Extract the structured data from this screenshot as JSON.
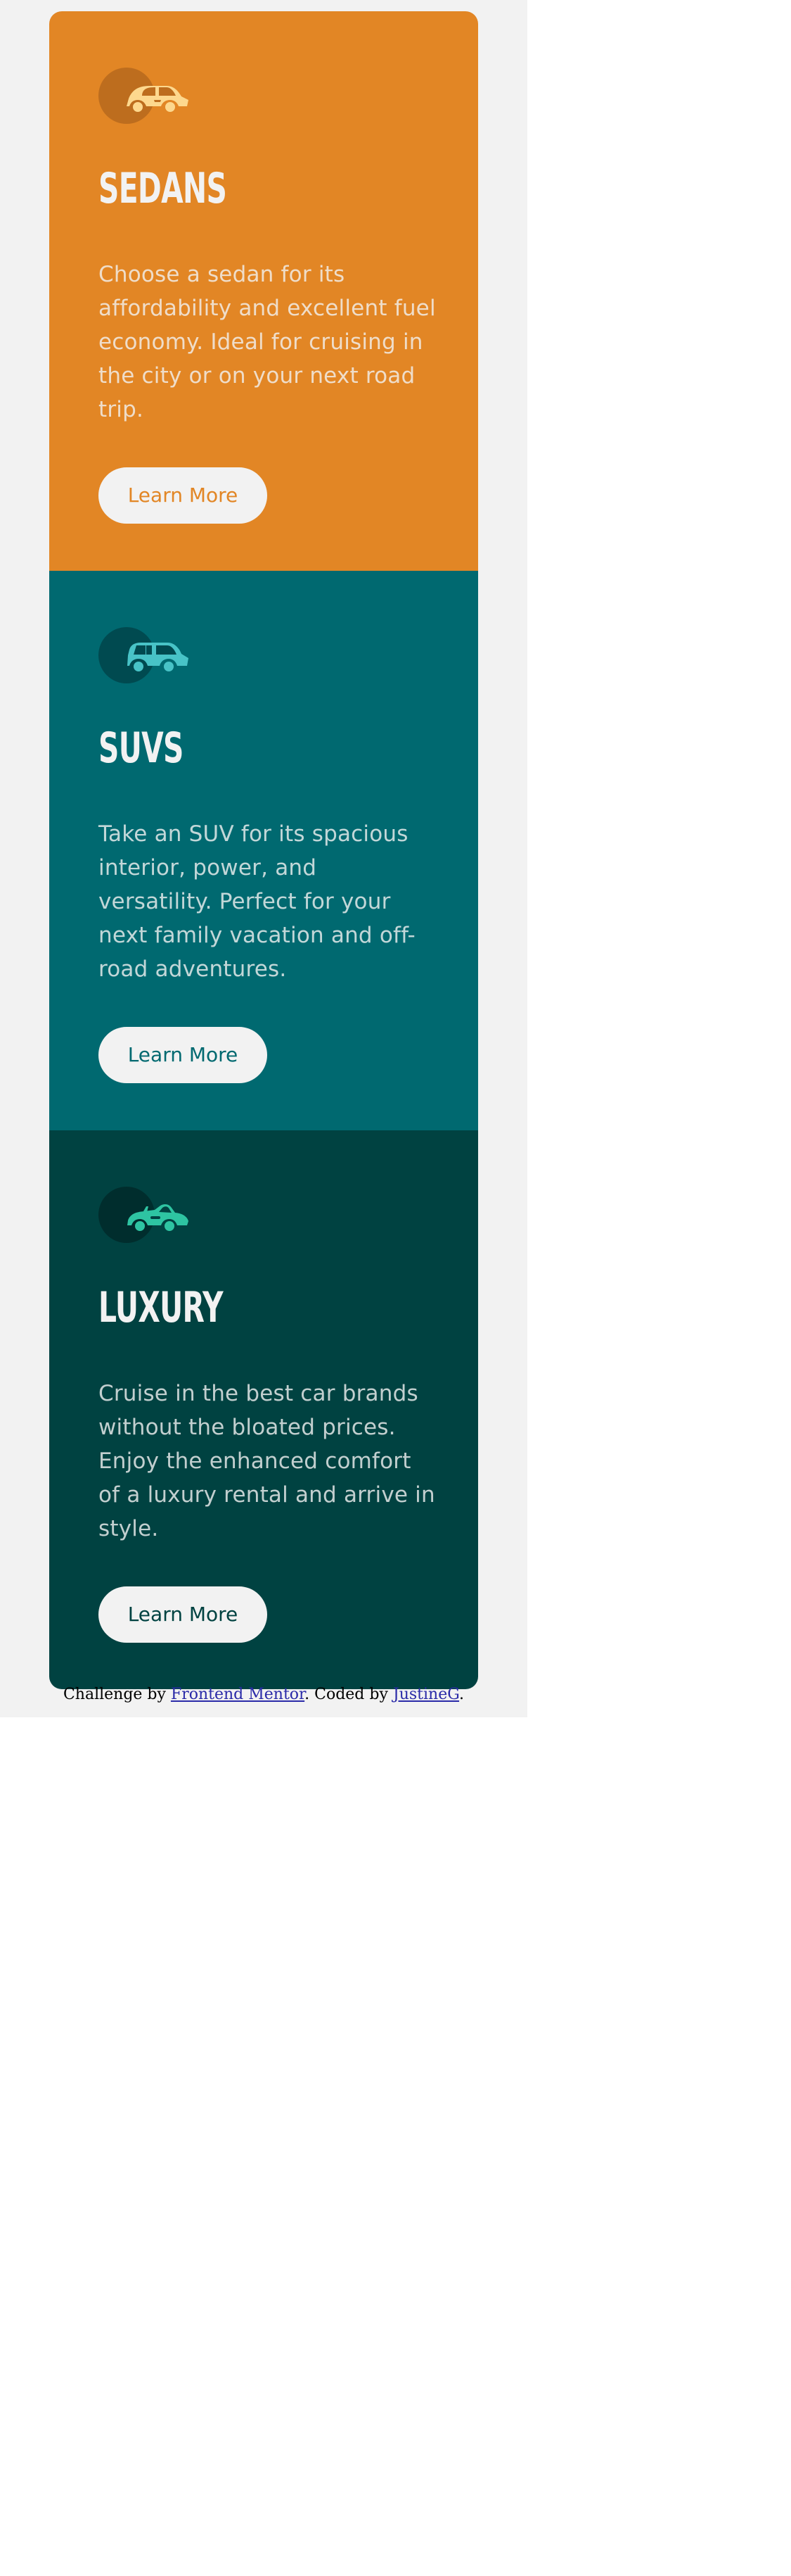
{
  "cards": [
    {
      "title": "SEDANS",
      "description": "Choose a sedan for its affordability and excellent fuel economy. Ideal for cruising in the city or on your next road trip.",
      "button_label": "Learn More",
      "icon": "sedan-car-icon",
      "colors": {
        "background": "#e28625",
        "icon_bubble": "#bd6d1e",
        "icon": "#fdd88e",
        "button_text": "#e28625"
      }
    },
    {
      "title": "SUVS",
      "description": "Take an SUV for its spacious interior, power, and versatility. Perfect for your next family vacation and off-road adventures.",
      "button_label": "Learn More",
      "icon": "suv-car-icon",
      "colors": {
        "background": "#006970",
        "icon_bubble": "#004a50",
        "icon": "#48c3c7",
        "button_text": "#006970"
      }
    },
    {
      "title": "LUXURY",
      "description": "Cruise in the best car brands without the bloated prices. Enjoy the enhanced comfort of a luxury rental and arrive in style.",
      "button_label": "Learn More",
      "icon": "luxury-car-icon",
      "colors": {
        "background": "#004241",
        "icon_bubble": "#002d2d",
        "icon": "#2ec4a2",
        "button_text": "#004241"
      }
    }
  ],
  "footer": {
    "prefix": "Challenge by ",
    "mentor_link": "Frontend Mentor",
    "middle": ". Coded by ",
    "author_link": "JustineG",
    "suffix": ".",
    "link_color": "#2a2aa8"
  },
  "page": {
    "background": "#f2f2f2"
  }
}
